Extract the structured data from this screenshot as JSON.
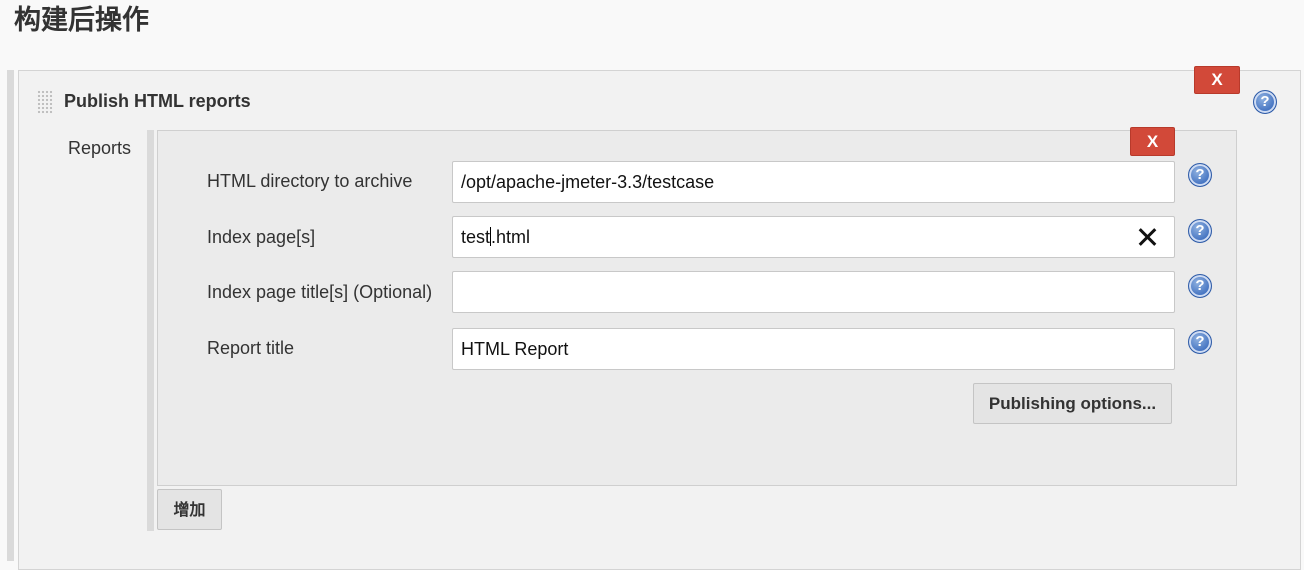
{
  "page": {
    "title": "构建后操作"
  },
  "publisher": {
    "title": "Publish HTML reports",
    "delete_label": "X",
    "help_glyph": "?",
    "reports": {
      "label": "Reports",
      "delete_label": "X",
      "fields": [
        {
          "label": "HTML directory to archive",
          "value": "/opt/apache-jmeter-3.3/testcase"
        },
        {
          "label": "Index page[s]",
          "value_before_caret": "test",
          "value_after_caret": ".html"
        },
        {
          "label": "Index page title[s] (Optional)",
          "value": ""
        },
        {
          "label": "Report title",
          "value": "HTML Report"
        }
      ],
      "publishing_options_label": "Publishing options..."
    },
    "add_label": "增加"
  },
  "icons": {
    "drag": "drag-handle-icon",
    "help": "help-icon",
    "clear": "clear-icon"
  },
  "colors": {
    "delete_button": "#d24939",
    "help_icon": "#3f6fbf",
    "background": "#f9f9f9"
  }
}
